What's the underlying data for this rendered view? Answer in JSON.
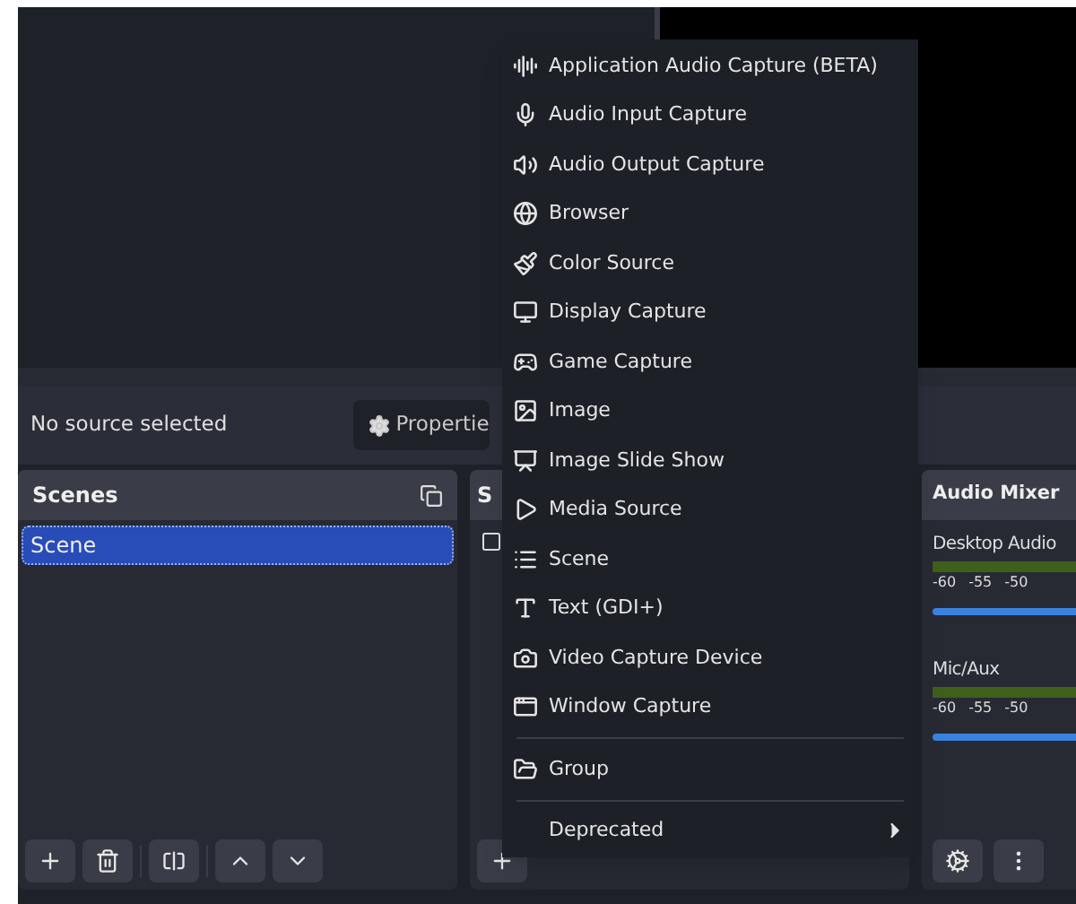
{
  "context_bar": {
    "status": "No source selected",
    "properties_button": "Propertie"
  },
  "scenes": {
    "title": "Scenes",
    "items": [
      {
        "label": "Scene",
        "selected": true
      }
    ]
  },
  "sources": {
    "title": "S"
  },
  "audio_mixer": {
    "title": "Audio Mixer",
    "channels": [
      {
        "name": "Desktop Audio",
        "ticks": [
          "-60",
          "-55",
          "-50"
        ],
        "level": 1
      },
      {
        "name": "Mic/Aux",
        "ticks": [
          "-60",
          "-55",
          "-50"
        ],
        "level": 1
      }
    ]
  },
  "menu": {
    "sections": [
      [
        {
          "label": "Application Audio Capture (BETA)",
          "submenu": false
        },
        {
          "label": "Audio Input Capture",
          "submenu": false
        },
        {
          "label": "Audio Output Capture",
          "submenu": false
        },
        {
          "label": "Browser",
          "submenu": false
        },
        {
          "label": "Color Source",
          "submenu": false
        },
        {
          "label": "Display Capture",
          "submenu": false
        },
        {
          "label": "Game Capture",
          "submenu": false
        },
        {
          "label": "Image",
          "submenu": false
        },
        {
          "label": "Image Slide Show",
          "submenu": false
        },
        {
          "label": "Media Source",
          "submenu": false
        },
        {
          "label": "Scene",
          "submenu": false
        },
        {
          "label": "Text (GDI+)",
          "submenu": false
        },
        {
          "label": "Video Capture Device",
          "submenu": false
        },
        {
          "label": "Window Capture",
          "submenu": false
        }
      ],
      [
        {
          "label": "Group",
          "submenu": false
        }
      ],
      [
        {
          "label": "Deprecated",
          "submenu": true
        }
      ]
    ]
  }
}
